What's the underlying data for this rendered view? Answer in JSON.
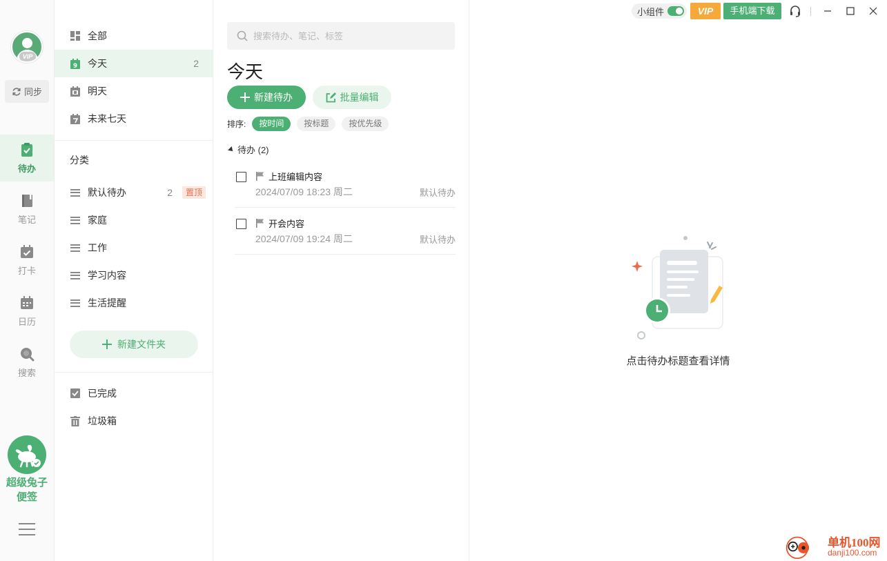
{
  "rail": {
    "avatar_badge": "VIP",
    "sync_label": "同步",
    "items": [
      {
        "label": "待办",
        "icon": "clipboard-check-icon",
        "active": true
      },
      {
        "label": "笔记",
        "icon": "notebook-icon",
        "active": false
      },
      {
        "label": "打卡",
        "icon": "calendar-check-icon",
        "active": false
      },
      {
        "label": "日历",
        "icon": "calendar-icon",
        "active": false
      },
      {
        "label": "搜索",
        "icon": "search-icon",
        "active": false
      }
    ],
    "brand_line1": "超级兔子",
    "brand_line2": "便签"
  },
  "categories": {
    "smart_lists": [
      {
        "label": "全部",
        "icon": "grid-icon",
        "count": ""
      },
      {
        "label": "今天",
        "icon": "calendar-today-icon",
        "count": "2",
        "active": true
      },
      {
        "label": "明天",
        "icon": "calendar-tomorrow-icon",
        "count": ""
      },
      {
        "label": "未来七天",
        "icon": "calendar-week-icon",
        "count": ""
      }
    ],
    "section_title": "分类",
    "folders": [
      {
        "label": "默认待办",
        "count": "2",
        "pin": "置顶"
      },
      {
        "label": "家庭",
        "count": "",
        "pin": ""
      },
      {
        "label": "工作",
        "count": "",
        "pin": ""
      },
      {
        "label": "学习内容",
        "count": "",
        "pin": ""
      },
      {
        "label": "生活提醒",
        "count": "",
        "pin": ""
      }
    ],
    "new_folder_label": "新建文件夹",
    "bottom": [
      {
        "label": "已完成",
        "icon": "checkbox-icon"
      },
      {
        "label": "垃圾箱",
        "icon": "trash-icon"
      }
    ]
  },
  "tasks": {
    "search_placeholder": "搜索待办、笔记、标签",
    "title": "今天",
    "new_button": "新建待办",
    "batch_button": "批量编辑",
    "sort_label": "排序:",
    "sort_options": [
      {
        "label": "按时间",
        "active": true
      },
      {
        "label": "按标题",
        "active": false
      },
      {
        "label": "按优先级",
        "active": false
      }
    ],
    "group_label": "待办 (2)",
    "items": [
      {
        "title": "上班编辑内容",
        "time": "2024/07/09 18:23 周二",
        "category": "默认待办"
      },
      {
        "title": "开会内容",
        "time": "2024/07/09 19:24 周二",
        "category": "默认待办"
      }
    ]
  },
  "toolbar": {
    "widget_label": "小组件",
    "widget_on": true,
    "vip_label": "VIP",
    "mobile_download": "手机端下载"
  },
  "detail": {
    "empty_text": "点击待办标题查看详情"
  },
  "watermark": {
    "name": "单机100网",
    "url": "danji100.com"
  },
  "colors": {
    "accent": "#4caf73",
    "accent_light": "#eaf5ed",
    "vip": "#f4a93a",
    "pin": "#e8704a"
  }
}
